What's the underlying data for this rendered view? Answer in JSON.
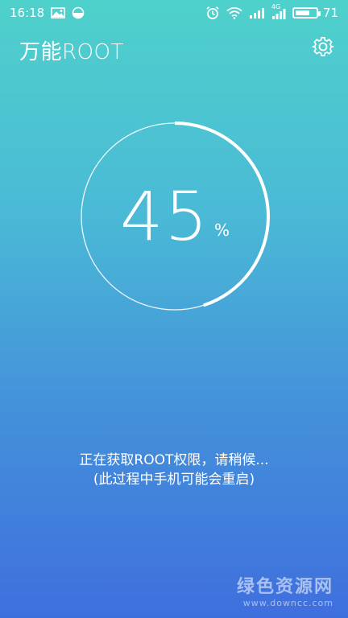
{
  "status_bar": {
    "time": "16:18",
    "battery_level": "71",
    "network_label": "4G",
    "icons": [
      "image-icon",
      "half-circle-icon",
      "alarm-icon",
      "wifi-icon",
      "signal-icon",
      "battery-icon"
    ]
  },
  "app": {
    "title": "万能ROOT",
    "settings_icon": "gear-icon"
  },
  "progress": {
    "value": "45",
    "unit": "%",
    "fraction": 0.45,
    "ring_color": "#ffffff"
  },
  "messages": {
    "line1": "正在获取ROOT权限，请稍候...",
    "line2": "(此过程中手机可能会重启)"
  },
  "watermark": {
    "main": "绿色资源网",
    "sub": "www.downcc.com"
  },
  "colors": {
    "gradient_top": "#4fd1cb",
    "gradient_bottom": "#3f6fdd",
    "text": "#ffffff"
  }
}
